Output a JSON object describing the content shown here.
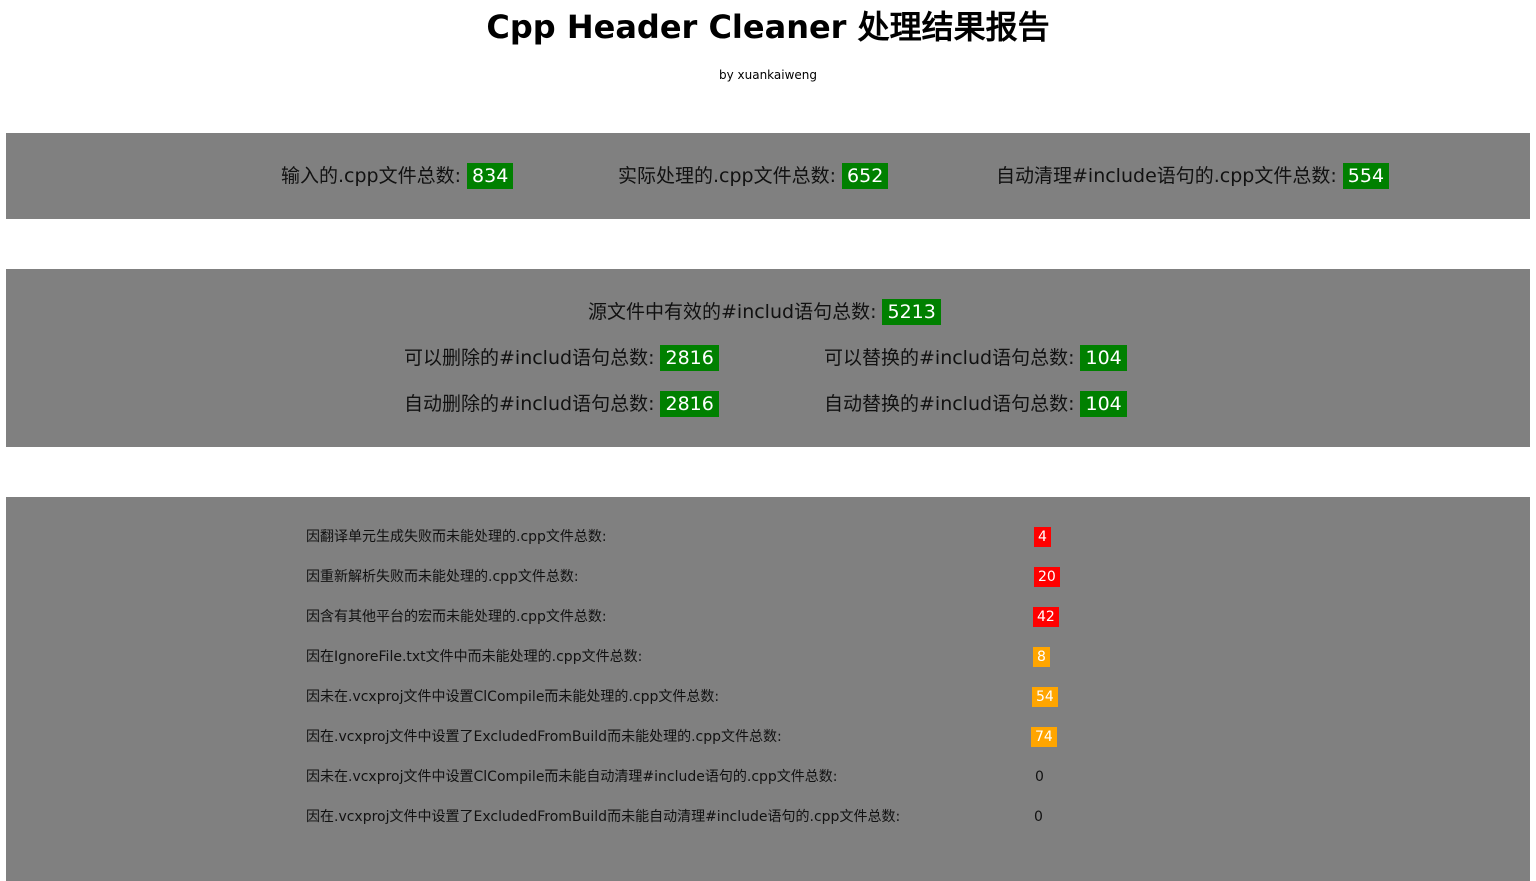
{
  "header": {
    "title": "Cpp Header Cleaner 处理结果报告",
    "byline": "by xuankaiweng"
  },
  "summary": {
    "input_label": "输入的.cpp文件总数:",
    "input_value": "834",
    "processed_label": "实际处理的.cpp文件总数:",
    "processed_value": "652",
    "cleaned_label": "自动清理#include语句的.cpp文件总数:",
    "cleaned_value": "554"
  },
  "includes": {
    "total_label": "源文件中有效的#includ语句总数:",
    "total_value": "5213",
    "deletable_label": "可以删除的#includ语句总数:",
    "deletable_value": "2816",
    "replaceable_label": "可以替换的#includ语句总数:",
    "replaceable_value": "104",
    "auto_deleted_label": "自动删除的#includ语句总数:",
    "auto_deleted_value": "2816",
    "auto_replaced_label": "自动替换的#includ语句总数:",
    "auto_replaced_value": "104"
  },
  "failures": [
    {
      "label": "因翻译单元生成失败而未能处理的.cpp文件总数:",
      "value": "4",
      "status": "red"
    },
    {
      "label": "因重新解析失败而未能处理的.cpp文件总数:",
      "value": "20",
      "status": "red"
    },
    {
      "label": "因含有其他平台的宏而未能处理的.cpp文件总数:",
      "value": "42",
      "status": "red"
    },
    {
      "label": "因在IgnoreFile.txt文件中而未能处理的.cpp文件总数:",
      "value": "8",
      "status": "orange"
    },
    {
      "label": "因未在.vcxproj文件中设置ClCompile而未能处理的.cpp文件总数:",
      "value": "54",
      "status": "orange"
    },
    {
      "label": "因在.vcxproj文件中设置了ExcludedFromBuild而未能处理的.cpp文件总数:",
      "value": "74",
      "status": "orange"
    },
    {
      "label": "因未在.vcxproj文件中设置ClCompile而未能自动清理#include语句的.cpp文件总数:",
      "value": "0",
      "status": "none"
    },
    {
      "label": "因在.vcxproj文件中设置了ExcludedFromBuild而未能自动清理#include语句的.cpp文件总数:",
      "value": "0",
      "status": "none"
    }
  ],
  "colors": {
    "panel": "#808080",
    "good": "#008000",
    "error": "#ff0000",
    "warning": "#ffa500"
  }
}
